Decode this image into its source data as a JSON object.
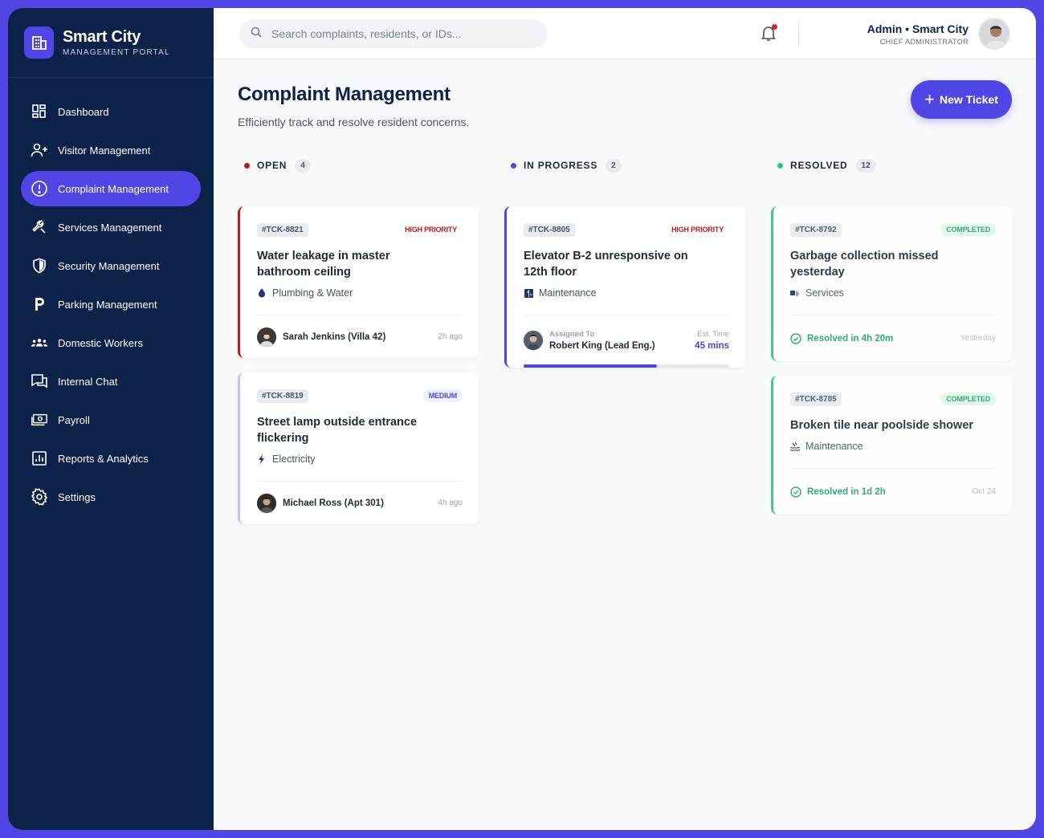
{
  "brand": {
    "title": "Smart City",
    "subtitle": "MANAGEMENT PORTAL"
  },
  "sidebar": {
    "items": [
      {
        "label": "Dashboard",
        "icon": "dashboard-icon"
      },
      {
        "label": "Visitor Management",
        "icon": "user-plus-icon"
      },
      {
        "label": "Complaint Management",
        "icon": "alert-circle-icon",
        "active": true
      },
      {
        "label": "Services Management",
        "icon": "wrench-icon"
      },
      {
        "label": "Security Management",
        "icon": "shield-icon"
      },
      {
        "label": "Parking Management",
        "icon": "parking-icon"
      },
      {
        "label": "Domestic Workers",
        "icon": "group-icon"
      },
      {
        "label": "Internal Chat",
        "icon": "chat-icon"
      },
      {
        "label": "Payroll",
        "icon": "money-icon"
      },
      {
        "label": "Reports & Analytics",
        "icon": "chart-icon"
      },
      {
        "label": "Settings",
        "icon": "gear-icon"
      }
    ]
  },
  "topbar": {
    "search_placeholder": "Search complaints, residents, or IDs...",
    "user_name": "Admin • Smart City",
    "user_role": "CHIEF ADMINISTRATOR"
  },
  "page": {
    "title": "Complaint Management",
    "subtitle": "Efficiently track and resolve resident concerns.",
    "new_button": "New Ticket"
  },
  "colors": {
    "accent": "#4f46e5",
    "sidebar": "#0c2248",
    "open": "#b91c1c",
    "progress": "#4f46e5",
    "resolved": "#34c28a",
    "medium_border": "#c4c2f4"
  },
  "columns": {
    "open": {
      "title": "OPEN",
      "count": "4",
      "cards": [
        {
          "id": "#TCK-8821",
          "priority": "HIGH PRIORITY",
          "title": "Water leakage in master bathroom ceiling",
          "category": "Plumbing & Water",
          "category_icon": "droplet-icon",
          "person": "Sarah Jenkins (Villa 42)",
          "time": "2h ago"
        },
        {
          "id": "#TCK-8819",
          "priority": "MEDIUM",
          "title": "Street lamp outside entrance flickering",
          "category": "Electricity",
          "category_icon": "bolt-icon",
          "person": "Michael Ross (Apt 301)",
          "time": "4h ago"
        }
      ]
    },
    "in_progress": {
      "title": "IN PROGRESS",
      "count": "2",
      "cards": [
        {
          "id": "#TCK-8805",
          "priority": "HIGH PRIORITY",
          "title": "Elevator B-2 unresponsive on 12th floor",
          "category": "Maintenance",
          "category_icon": "elevator-icon",
          "assigned_label": "Assigned To",
          "assigned_name": "Robert King (Lead Eng.)",
          "est_label": "Est. Time",
          "est_value": "45 mins",
          "progress": 0.65
        }
      ]
    },
    "resolved": {
      "title": "RESOLVED",
      "count": "12",
      "cards": [
        {
          "id": "#TCK-8792",
          "status": "COMPLETED",
          "title": "Garbage collection missed yesterday",
          "category": "Services",
          "category_icon": "truck-icon",
          "resolved": "Resolved in 4h 20m",
          "time": "Yesterday"
        },
        {
          "id": "#TCK-8785",
          "status": "COMPLETED",
          "title": "Broken tile near poolside shower",
          "category": "Maintenance",
          "category_icon": "pool-icon",
          "resolved": "Resolved in 1d 2h",
          "time": "Oct 24"
        }
      ]
    }
  }
}
